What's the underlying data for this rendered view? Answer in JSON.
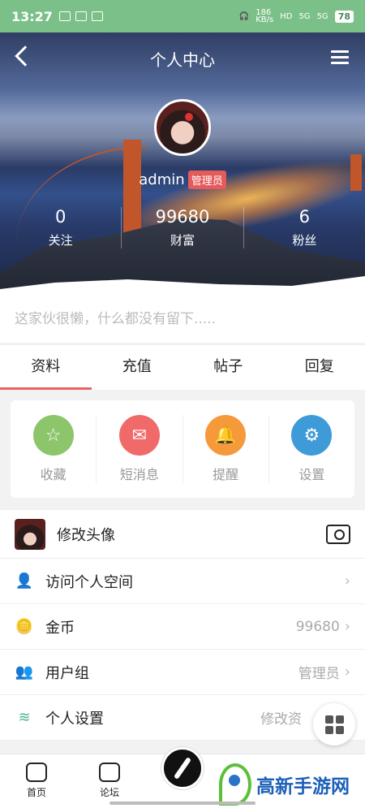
{
  "status_bar": {
    "time": "13:27",
    "network_speed": "186\nKB/s",
    "hd": "HD",
    "sim1": "5G",
    "sim2": "5G",
    "battery": "78"
  },
  "header": {
    "title": "个人中心"
  },
  "profile": {
    "username": "admin",
    "role_badge": "管理员"
  },
  "stats": [
    {
      "value": "0",
      "label": "关注"
    },
    {
      "value": "99680",
      "label": "财富"
    },
    {
      "value": "6",
      "label": "粉丝"
    }
  ],
  "signature": "这家伙很懒，什么都没有留下.....",
  "tabs": [
    {
      "label": "资料"
    },
    {
      "label": "充值"
    },
    {
      "label": "帖子"
    },
    {
      "label": "回复"
    }
  ],
  "quick_actions": [
    {
      "label": "收藏",
      "color": "#8dc56b",
      "glyph": "☆"
    },
    {
      "label": "短消息",
      "color": "#f06a6a",
      "glyph": "✉"
    },
    {
      "label": "提醒",
      "color": "#f6993a",
      "glyph": "🔔"
    },
    {
      "label": "设置",
      "color": "#3f9ad8",
      "glyph": "⚙"
    }
  ],
  "list": {
    "edit_avatar": "修改头像",
    "visit_space": "访问个人空间",
    "coins": {
      "label": "金币",
      "value": "99680"
    },
    "user_group": {
      "label": "用户组",
      "value": "管理员"
    },
    "settings": {
      "label": "个人设置",
      "value": "修改资"
    }
  },
  "bottom_nav": [
    {
      "label": "首页"
    },
    {
      "label": "论坛"
    }
  ],
  "watermark": "高新手游网"
}
